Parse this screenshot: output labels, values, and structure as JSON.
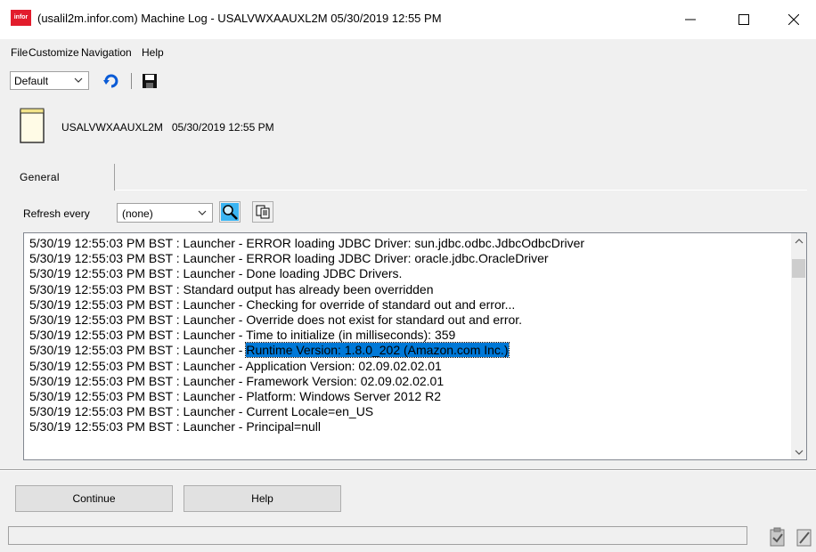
{
  "window": {
    "app_icon_text": "infor",
    "title": "(usalil2m.infor.com) Machine Log - USALVWXAAUXL2M   05/30/2019 12:55 PM"
  },
  "menu": [
    "File",
    "Customize",
    "Navigation",
    "Help"
  ],
  "toolbar": {
    "layout_value": "Default",
    "icons": [
      "refresh-icon",
      "save-icon"
    ]
  },
  "header": {
    "machine": "USALVWXAAUXL2M",
    "datetime": "05/30/2019 12:55 PM"
  },
  "tabs": [
    {
      "label": "General",
      "active": true
    }
  ],
  "refresh": {
    "label": "Refresh every",
    "value": "(none)"
  },
  "log": {
    "lines": [
      "5/30/19 12:55:03 PM BST : Launcher - ERROR loading JDBC Driver: sun.jdbc.odbc.JdbcOdbcDriver",
      "5/30/19 12:55:03 PM BST : Launcher - ERROR loading JDBC Driver: oracle.jdbc.OracleDriver",
      "5/30/19 12:55:03 PM BST : Launcher - Done loading JDBC Drivers.",
      "5/30/19 12:55:03 PM BST : Standard output has already been overridden",
      "5/30/19 12:55:03 PM BST : Launcher - Checking for override of standard out and error...",
      "5/30/19 12:55:03 PM BST : Launcher - Override does not exist for standard out and error.",
      "5/30/19 12:55:03 PM BST : Launcher - Time to initialize (in milliseconds): 359",
      "5/30/19 12:55:03 PM BST : Launcher - ",
      "5/30/19 12:55:03 PM BST : Launcher - Application Version: 02.09.02.02.01",
      "5/30/19 12:55:03 PM BST : Launcher - Framework Version: 02.09.02.02.01",
      "5/30/19 12:55:03 PM BST : Launcher - Platform: Windows Server 2012 R2",
      "5/30/19 12:55:03 PM BST : Launcher - Current Locale=en_US",
      "5/30/19 12:55:03 PM BST : Launcher - Principal=null"
    ],
    "selected_text": "Runtime Version: 1.8.0_202 (Amazon.com Inc.)",
    "selection_color": "#0078d7"
  },
  "buttons": {
    "continue": "Continue",
    "help": "Help"
  },
  "colors": {
    "brand": "#e21c2c",
    "refresh_icon": "#0a5bd6"
  }
}
